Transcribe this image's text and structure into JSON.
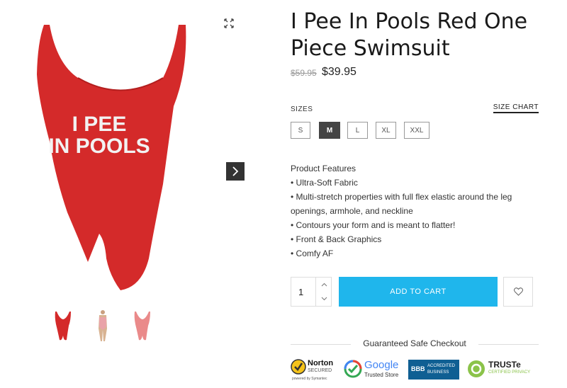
{
  "product": {
    "title": "I Pee In Pools Red One Piece Swimsuit",
    "old_price": "$59.95",
    "price": "$39.95",
    "image_text": [
      "I PEE",
      "IN POOLS"
    ]
  },
  "sizes": {
    "label": "SIZES",
    "chart_link": "SIZE CHART",
    "options": [
      "S",
      "M",
      "L",
      "XL",
      "XXL"
    ],
    "selected": "M"
  },
  "features": {
    "heading": "Product Features",
    "items": [
      "• Ultra-Soft Fabric",
      "• Multi-stretch properties with full flex elastic around the leg openings, armhole, and neckline",
      "• Contours your form and is meant to flatter!",
      "• Front & Back Graphics",
      "• Comfy AF"
    ]
  },
  "cart": {
    "quantity": "1",
    "add_label": "ADD TO CART"
  },
  "checkout": {
    "heading": "Guaranteed Safe Checkout",
    "badges": {
      "norton": {
        "name": "Norton",
        "sub": "SECURED",
        "powered": "powered by Symantec"
      },
      "google": {
        "name": "Google",
        "sub": "Trusted Store"
      },
      "bbb": {
        "logo": "BBB",
        "line1": "ACCREDITED",
        "line2": "BUSINESS"
      },
      "truste": {
        "name": "TRUSTe",
        "sub": "CERTIFIED PRIVACY"
      }
    }
  },
  "colors": {
    "accent": "#1fb6ec",
    "swimsuit": "#d42a2a",
    "selected_size": "#444444"
  },
  "icons": [
    "expand-icon",
    "chevron-right-icon",
    "chevron-up-icon",
    "chevron-down-icon",
    "heart-icon"
  ]
}
